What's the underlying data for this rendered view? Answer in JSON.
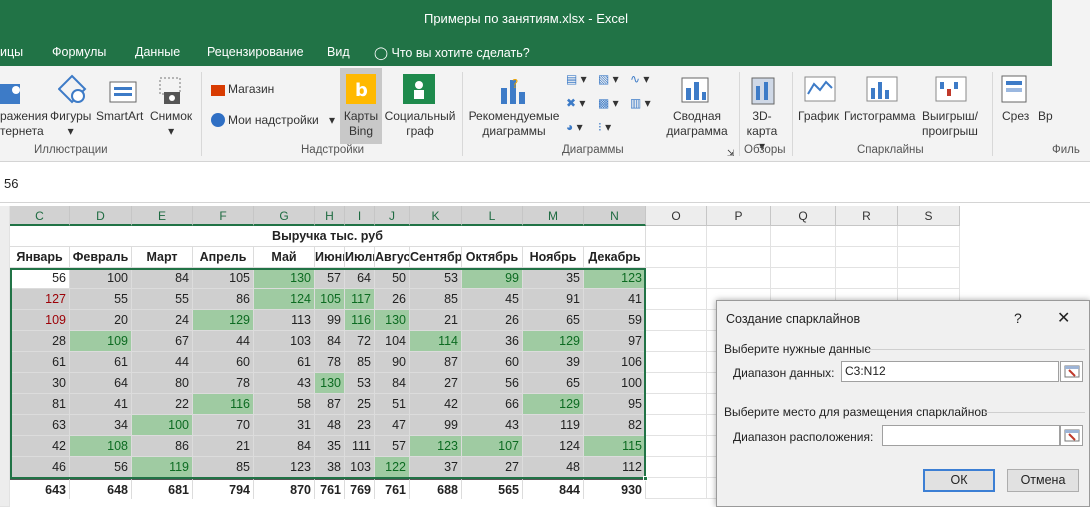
{
  "window": {
    "title": "Примеры по занятиям.xlsx - Excel"
  },
  "tabs": {
    "t0": "ицы",
    "t1": "Формулы",
    "t2": "Данные",
    "t3": "Рецензирование",
    "t4": "Вид",
    "tell": "Что вы хотите сделать?"
  },
  "ribbon": {
    "illus": {
      "b1a": "ражения",
      "b1b": "тернета",
      "b2a": "Фигуры",
      "b3a": "SmartArt",
      "b4a": "Снимок",
      "group": "Иллюстрации"
    },
    "addins": {
      "store": "Магазин",
      "my": "Мои надстройки",
      "bing_a": "Карты",
      "bing_b": "Bing",
      "people_a": "Социальный",
      "people_b": "граф",
      "group": "Надстройки"
    },
    "charts": {
      "rec_a": "Рекомендуемые",
      "rec_b": "диаграммы",
      "pivot_a": "Сводная",
      "pivot_b": "диаграмма",
      "group": "Диаграммы"
    },
    "tours": {
      "map_a": "3D-",
      "map_b": "карта",
      "group": "Обзоры"
    },
    "spark": {
      "line": "График",
      "col": "Гистограмма",
      "wl_a": "Выигрыш/",
      "wl_b": "проигрыш",
      "group": "Спарклайны"
    },
    "filters": {
      "slicer": "Срез",
      "tl": "Вр",
      "group": "Филь"
    }
  },
  "colors": {
    "excel_green": "#217346",
    "highlight": "#9fcba2",
    "shade": "#cfcfcf"
  },
  "formula": {
    "value": "56"
  },
  "sheet": {
    "cols": [
      "C",
      "D",
      "E",
      "F",
      "G",
      "H",
      "I",
      "J",
      "K",
      "L",
      "M",
      "N",
      "O",
      "P",
      "Q",
      "R",
      "S"
    ],
    "title": "Выручка тыс. руб",
    "months": [
      "Январь",
      "Февраль",
      "Март",
      "Апрель",
      "Май",
      "Июнь",
      "Июль",
      "Август",
      "Сентябрь",
      "Октябрь",
      "Ноябрь",
      "Декабрь"
    ],
    "rows": [
      [
        56,
        100,
        84,
        105,
        130,
        57,
        64,
        50,
        53,
        99,
        35,
        123
      ],
      [
        127,
        55,
        55,
        86,
        124,
        105,
        117,
        26,
        85,
        45,
        91,
        41
      ],
      [
        109,
        20,
        24,
        129,
        113,
        99,
        116,
        130,
        21,
        26,
        65,
        59
      ],
      [
        28,
        109,
        67,
        44,
        103,
        84,
        72,
        104,
        114,
        36,
        129,
        97
      ],
      [
        61,
        61,
        44,
        60,
        61,
        78,
        85,
        90,
        87,
        60,
        39,
        106
      ],
      [
        30,
        64,
        80,
        78,
        43,
        130,
        53,
        84,
        27,
        56,
        65,
        100
      ],
      [
        81,
        41,
        22,
        116,
        58,
        87,
        25,
        51,
        42,
        66,
        129,
        95
      ],
      [
        63,
        34,
        100,
        70,
        31,
        48,
        23,
        47,
        99,
        43,
        119,
        82
      ],
      [
        42,
        108,
        86,
        21,
        84,
        35,
        111,
        57,
        123,
        107,
        124,
        115
      ],
      [
        46,
        56,
        119,
        85,
        123,
        38,
        103,
        122,
        37,
        27,
        48,
        112
      ]
    ],
    "totals": [
      643,
      648,
      681,
      794,
      870,
      761,
      769,
      761,
      688,
      565,
      844,
      930
    ]
  },
  "dialog": {
    "title": "Создание спарклайнов",
    "help": "?",
    "close": "✕",
    "section1": "Выберите нужные данные",
    "data_label": "Диапазон данных:",
    "data_value": "C3:N12",
    "section2": "Выберите место для размещения спарклайнов",
    "loc_label": "Диапазон расположения:",
    "loc_value": "",
    "ok": "ОК",
    "cancel": "Отмена"
  }
}
